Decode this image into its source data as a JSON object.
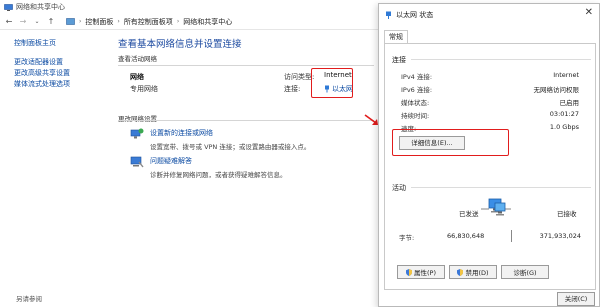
{
  "window": {
    "title": "网络和共享中心"
  },
  "breadcrumb": {
    "items": [
      "控制面板",
      "所有控制面板项",
      "网络和共享中心"
    ]
  },
  "sidebar": {
    "items": [
      {
        "label": "控制面板主页"
      },
      {
        "label": "更改适配器设置"
      },
      {
        "label": "更改高级共享设置"
      },
      {
        "label": "媒体流式处理选项"
      }
    ],
    "see_also": "另请参阅"
  },
  "main": {
    "title": "查看基本网络信息并设置连接",
    "active_networks_label": "查看活动网络",
    "network_name": "网络",
    "network_type": "专用网络",
    "access_type_label": "访问类型:",
    "access_type_value": "Internet",
    "connection_label": "连接:",
    "connection_value": "以太网",
    "change_settings_label": "更改网络设置",
    "tasks": [
      {
        "title": "设置新的连接或网络",
        "desc": "设置宽带、拨号或 VPN 连接；或设置路由器或接入点。"
      },
      {
        "title": "问题疑难解答",
        "desc": "诊断并修复网络问题，或者获得疑难解答信息。"
      }
    ]
  },
  "dialog": {
    "title": "以太网 状态",
    "tab": "常规",
    "connection_group": "连接",
    "rows": [
      {
        "label": "IPv4 连接:",
        "value": "Internet"
      },
      {
        "label": "IPv6 连接:",
        "value": "无网络访问权限"
      },
      {
        "label": "媒体状态:",
        "value": "已启用"
      },
      {
        "label": "持续时间:",
        "value": "03:01:27"
      },
      {
        "label": "速度:",
        "value": "1.0 Gbps"
      }
    ],
    "details_button": "详细信息(E)...",
    "activity_group": "活动",
    "sent_label": "已发送",
    "received_label": "已接收",
    "bytes_label": "字节:",
    "bytes_sent": "66,830,648",
    "bytes_received": "371,933,024",
    "buttons": {
      "properties": "属性(P)",
      "disable": "禁用(D)",
      "diagnose": "诊断(G)"
    },
    "close_button": "关闭(C)"
  },
  "colors": {
    "link": "#0b4aa2",
    "title": "#1c4aa0",
    "highlight": "#e11d1d"
  }
}
